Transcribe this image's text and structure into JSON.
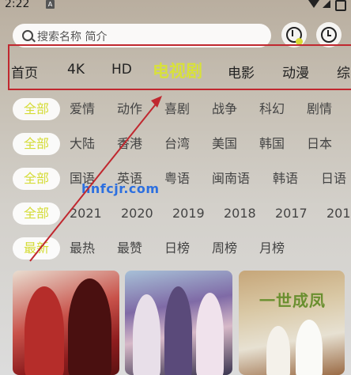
{
  "status_bar": {
    "time": "2:22",
    "notification_badge": "A"
  },
  "search": {
    "placeholder": "搜索名称 简介"
  },
  "header_actions": {
    "download_icon": "download-icon",
    "history_icon": "history-icon",
    "accent": "#d8e13a"
  },
  "categories": [
    {
      "label": "首页"
    },
    {
      "label": "4K"
    },
    {
      "label": "HD"
    },
    {
      "label": "电视剧",
      "active": true
    },
    {
      "label": "电影"
    },
    {
      "label": "动漫"
    },
    {
      "label": "综"
    }
  ],
  "filters": {
    "genre": [
      "全部",
      "爱情",
      "动作",
      "喜剧",
      "战争",
      "科幻",
      "剧情"
    ],
    "region": [
      "全部",
      "大陆",
      "香港",
      "台湾",
      "美国",
      "韩国",
      "日本"
    ],
    "language": [
      "全部",
      "国语",
      "英语",
      "粤语",
      "闽南语",
      "韩语",
      "日语"
    ],
    "year": [
      "全部",
      "2021",
      "2020",
      "2019",
      "2018",
      "2017",
      "201"
    ],
    "sort": [
      "最新",
      "最热",
      "最赞",
      "日榜",
      "周榜",
      "月榜"
    ]
  },
  "watermark": "hnfcjr.com",
  "posters": [
    {
      "title": ""
    },
    {
      "title": ""
    },
    {
      "title": "一世成凤"
    }
  ],
  "colors": {
    "selected_text": "#d5dc36",
    "highlight_box": "#c0282f"
  }
}
